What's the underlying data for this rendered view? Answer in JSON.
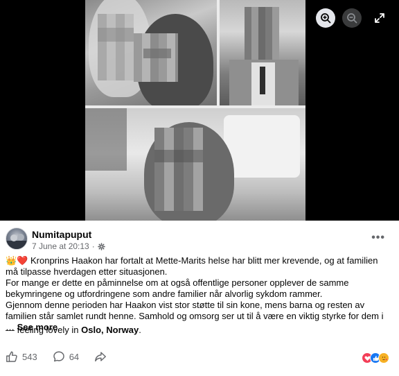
{
  "viewer": {
    "icons": [
      "zoom-in-icon",
      "zoom-out-icon",
      "expand-icon"
    ]
  },
  "post": {
    "author": "Numitapuput",
    "date": "7 June at 20:13",
    "audience_icon": "gear-icon",
    "emoji_prefix": "👑❤️",
    "paragraphs": [
      " Kronprins Haakon har fortalt at Mette-Marits helse har blitt mer krevende, og at familien må tilpasse hverdagen etter situasjonen.",
      "For mange er dette en påminnelse om at også offentlige personer opplever de samme bekymringene og utfordringene som andre familier når alvorlig sykdom rammer.",
      "Gjennom denne perioden har Haakon vist stor støtte til sin kone, mens barna og resten av familien står samlet rundt henne. Samhold og omsorg ser ut til å være en viktig styrke for dem i … "
    ],
    "see_more": "See more",
    "feeling_prefix": "— feeling lovely in ",
    "location": "Oslo, Norway",
    "feeling_suffix": "."
  },
  "actions": {
    "likes": "543",
    "comments": "64"
  },
  "colors": {
    "viewer_bg": "#000000",
    "muted_text": "#65676b",
    "like_blue": "#1877f2",
    "love_red": "#f33e58",
    "care_yellow": "#f7b125"
  }
}
